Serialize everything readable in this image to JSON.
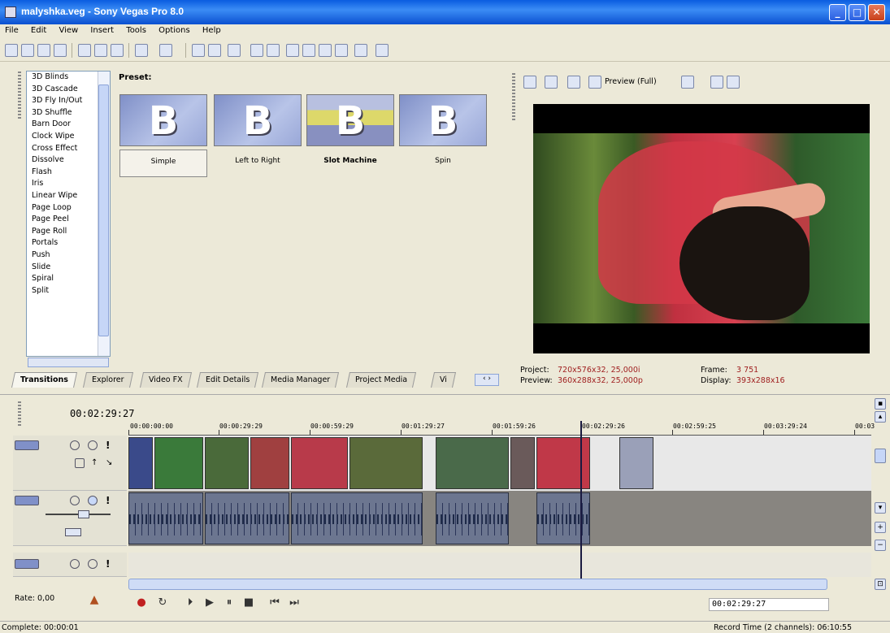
{
  "window": {
    "title": "malyshka.veg - Sony Vegas Pro 8.0",
    "buttons": {
      "minimize": "_",
      "maximize": "□",
      "close": "✕"
    }
  },
  "menu": [
    "File",
    "Edit",
    "View",
    "Insert",
    "Tools",
    "Options",
    "Help"
  ],
  "transitions": {
    "items": [
      "3D Blinds",
      "3D Cascade",
      "3D Fly In/Out",
      "3D Shuffle",
      "Barn Door",
      "Clock Wipe",
      "Cross Effect",
      "Dissolve",
      "Flash",
      "Iris",
      "Linear Wipe",
      "Page Loop",
      "Page Peel",
      "Page Roll",
      "Portals",
      "Push",
      "Slide",
      "Spiral",
      "Split"
    ]
  },
  "presets": {
    "label": "Preset:",
    "items": [
      {
        "name": "Simple",
        "glyph": "B"
      },
      {
        "name": "Left to Right",
        "glyph": "B"
      },
      {
        "name": "Slot Machine",
        "glyph": "B"
      },
      {
        "name": "Spin",
        "glyph": "B"
      }
    ]
  },
  "tabs": [
    "Transitions",
    "Explorer",
    "Video FX",
    "Edit Details",
    "Media Manager",
    "Project Media",
    "Vi"
  ],
  "preview": {
    "mode": "Preview (Full)",
    "project_label": "Project:",
    "project_value": "720x576x32, 25,000i",
    "preview_label": "Preview:",
    "preview_value": "360x288x32, 25,000p",
    "frame_label": "Frame:",
    "frame_value": "3 751",
    "display_label": "Display:",
    "display_value": "393x288x16"
  },
  "timeline": {
    "current_time": "00:02:29:27",
    "ruler": [
      "00:00:00:00",
      "00:00:29:29",
      "00:00:59:29",
      "00:01:29:27",
      "00:01:59:26",
      "00:02:29:26",
      "00:02:59:25",
      "00:03:29:24",
      "00:03"
    ],
    "rate": "Rate: 0,00",
    "time_box": "00:02:29:27"
  },
  "status": {
    "left": "Complete: 00:00:01",
    "right": "Record Time (2 channels): 06:10:55"
  },
  "colors": {
    "titlebar": "#0a5ce0",
    "cursor": "#1a1a40",
    "audio_track": "#888580",
    "info_value": "#a02020"
  },
  "icons": {
    "record": "●",
    "loop": "↻",
    "play_from_start": "⏵",
    "play": "▶",
    "pause": "⏸",
    "stop": "■",
    "prev": "⏮",
    "next": "⏭"
  }
}
